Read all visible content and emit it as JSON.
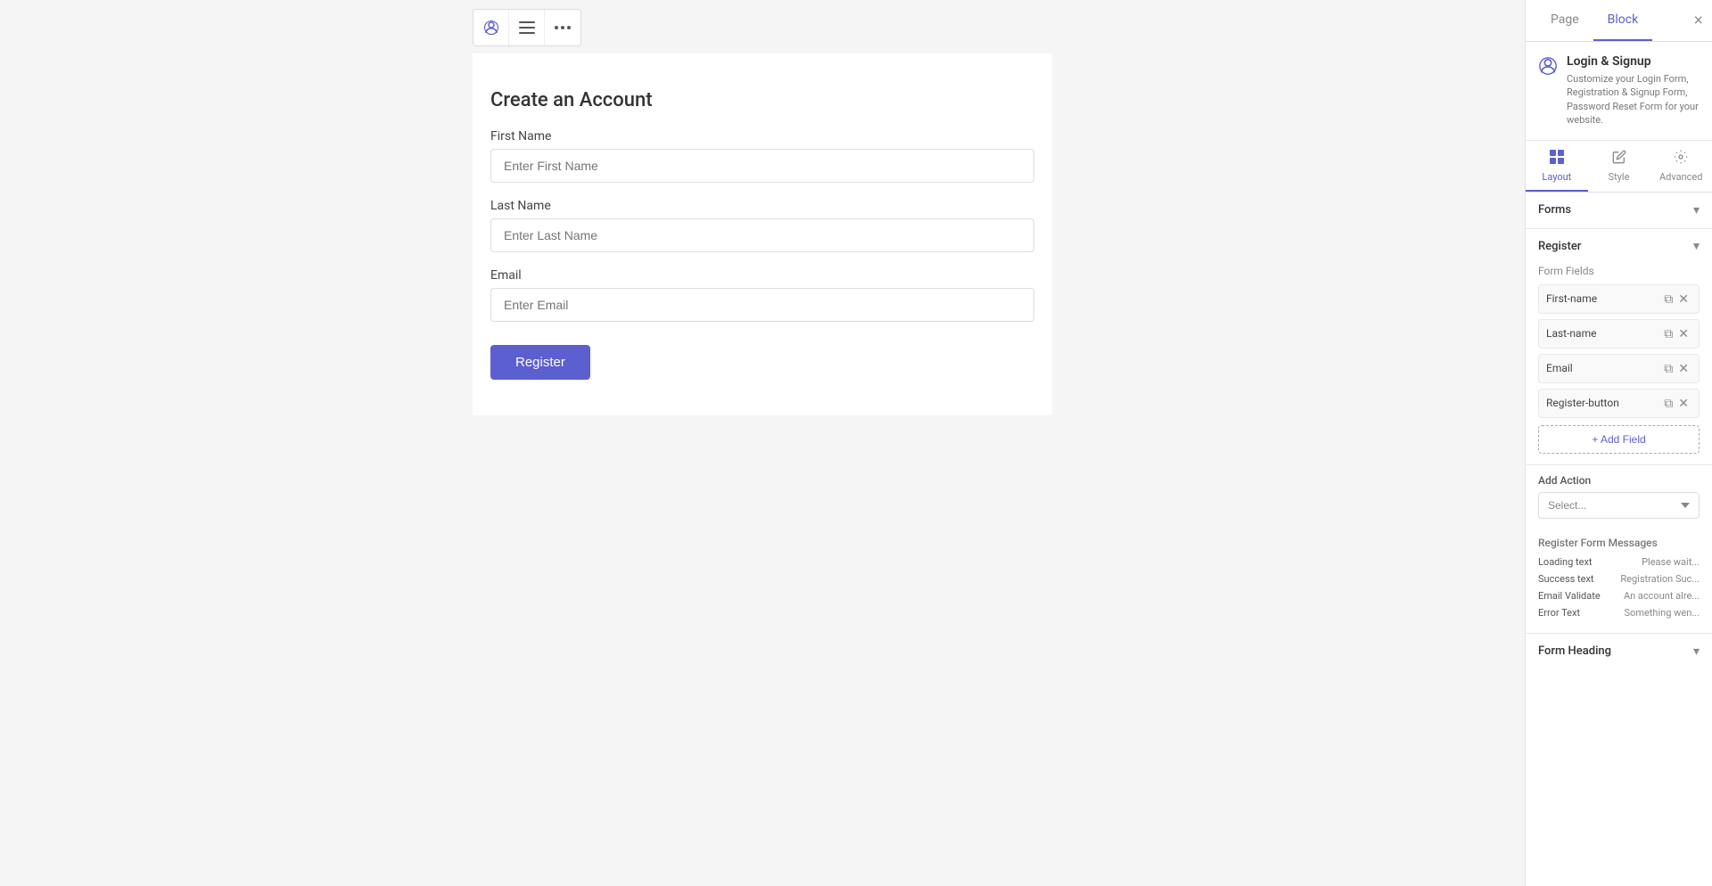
{
  "panel": {
    "tabs": [
      {
        "label": "Page",
        "active": false
      },
      {
        "label": "Block",
        "active": true
      }
    ],
    "close_label": "×",
    "plugin": {
      "title": "Login & Signup",
      "description": "Customize your Login Form, Registration & Signup Form, Password Reset Form for your website."
    },
    "sub_tabs": [
      {
        "label": "Layout",
        "active": true,
        "icon": "▦"
      },
      {
        "label": "Style",
        "active": false,
        "icon": "✏"
      },
      {
        "label": "Advanced",
        "active": false,
        "icon": "⚙"
      }
    ],
    "forms_section": {
      "label": "Forms",
      "expanded": false
    },
    "register_section": {
      "label": "Register",
      "expanded": true,
      "form_fields_label": "Form Fields",
      "fields": [
        {
          "label": "First-name"
        },
        {
          "label": "Last-name"
        },
        {
          "label": "Email"
        },
        {
          "label": "Register-button"
        }
      ],
      "add_field_label": "+ Add Field"
    },
    "add_action": {
      "label": "Add Action",
      "placeholder": "Select..."
    },
    "register_form_messages": {
      "label": "Register Form Messages",
      "rows": [
        {
          "key": "Loading text",
          "value": "Please wait..."
        },
        {
          "key": "Success text",
          "value": "Registration Suc..."
        },
        {
          "key": "Email Validate",
          "value": "An account alre..."
        },
        {
          "key": "Error Text",
          "value": "Something wen..."
        }
      ]
    },
    "form_heading": {
      "label": "Form Heading"
    }
  },
  "canvas": {
    "toolbar_buttons": [
      {
        "icon": "👤",
        "label": "user-icon"
      },
      {
        "icon": "☰",
        "label": "menu-icon"
      },
      {
        "icon": "⋯",
        "label": "more-icon"
      }
    ],
    "form": {
      "title": "Create an Account",
      "fields": [
        {
          "label": "First Name",
          "placeholder": "Enter First Name"
        },
        {
          "label": "Last Name",
          "placeholder": "Enter Last Name"
        },
        {
          "label": "Email",
          "placeholder": "Enter Email"
        }
      ],
      "button_label": "Register"
    }
  }
}
